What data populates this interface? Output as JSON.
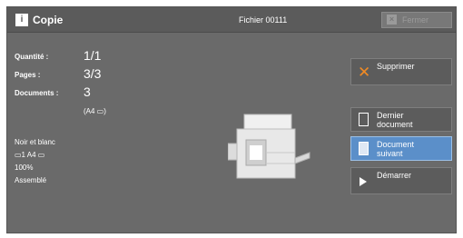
{
  "titlebar": {
    "app_title": "Copie",
    "file_title": "Fichier 00111",
    "close_label": "Fermer"
  },
  "info": {
    "quantity_label": "Quantité :",
    "quantity_value": "1/1",
    "pages_label": "Pages :",
    "pages_value": "3/3",
    "documents_label": "Documents :",
    "documents_value": "3",
    "documents_format": "(A4 ▭)"
  },
  "settings": {
    "color_mode": "Noir et blanc",
    "tray_line": "▭1   A4 ▭",
    "zoom": "100%",
    "finishing": "Assemblé"
  },
  "actions": {
    "delete_label": "Supprimer",
    "last_doc_label_1": "Dernier",
    "last_doc_label_2": "document",
    "next_doc_label_1": "Document",
    "next_doc_label_2": "suivant",
    "start_label": "Démarrer"
  },
  "colors": {
    "screen_bg": "#6a6a6a",
    "selected_button": "#5b8fc9",
    "delete_icon": "#f08a24"
  },
  "icons": [
    "copy-app-icon",
    "close-icon",
    "delete-icon",
    "document-icon",
    "play-icon",
    "printer-illustration"
  ]
}
